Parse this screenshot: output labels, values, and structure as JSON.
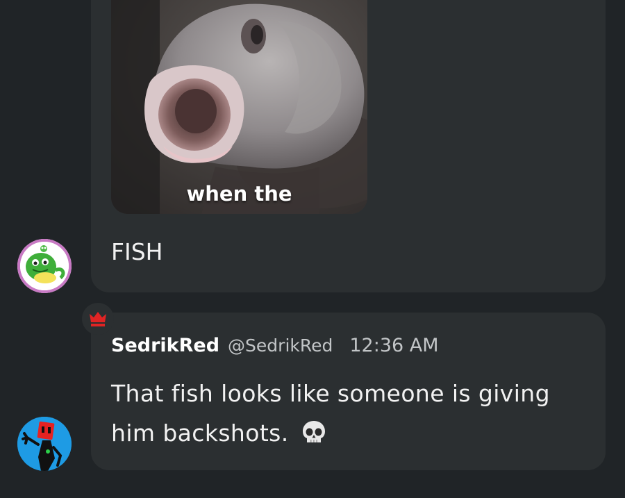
{
  "messages": [
    {
      "media": {
        "caption": "when the",
        "kind": "gif"
      },
      "text": "FISH",
      "avatar_icon": "frog-avatar-icon"
    },
    {
      "author": "SedrikRed",
      "handle": "@SedrikRed",
      "time": "12:36 AM",
      "text": "That fish looks like someone is giving him backshots.",
      "emoji": "skull-emoji",
      "badge_icon": "crown-icon",
      "avatar_icon": "red-robot-avatar-icon"
    }
  ],
  "colors": {
    "background": "#202427",
    "bubble": "#2b2f31",
    "crown": "#e02424",
    "avatar_ring": "#c879c4",
    "avatar_2_bg": "#1e9be4"
  }
}
